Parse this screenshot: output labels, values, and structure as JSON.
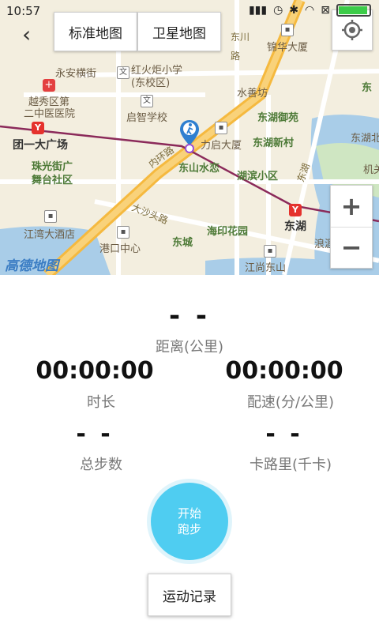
{
  "status_bar": {
    "time": "10:57"
  },
  "map": {
    "buttons": {
      "standard": "标准地图",
      "satellite": "卫星地图"
    },
    "zoom_in": "+",
    "zoom_out": "−",
    "logo": "高德地图",
    "labels": {
      "yongan": "永安横街",
      "hongyan": "红火炬小学",
      "hongyan_sub": "(东校区)",
      "yuexiu_hospital": "越秀区第",
      "yuexiu_hospital2": "二中医医院",
      "qizhi": "启智学校",
      "tuanyi": "团一大广场",
      "zhuguang": "珠光街广",
      "zhuguang2": "舞台社区",
      "huanlu": "内环路",
      "dongshan_shuilian": "东山水恋",
      "liqi": "力启大厦",
      "shuishan": "水善坊",
      "dongchuan": "东川",
      "dongchuan_road": "路",
      "jinhua": "锦华大厦",
      "donghu_yu": "东湖御苑",
      "donghu_xin": "东湖新村",
      "hubin": "湖滨小区",
      "donghu_road": "东湖",
      "donghu_road2": "路",
      "donghu": "东湖",
      "donghu_north": "东湖北",
      "dongshan": "东",
      "jiguan": "机关",
      "dasha": "大沙头路",
      "haiyin": "海印花园",
      "dongcheng": "东城",
      "jiangwan": "江湾大酒店",
      "gangkou": "港口中心",
      "jiangshang": "江尚东山",
      "langxue": "浪涯花园"
    }
  },
  "stats": {
    "distance": {
      "value": "- -",
      "label": "距离(公里)"
    },
    "duration": {
      "value": "00:00:00",
      "label": "时长"
    },
    "pace": {
      "value": "00:00:00",
      "label": "配速(分/公里)"
    },
    "steps": {
      "value": "- -",
      "label": "总步数"
    },
    "calories": {
      "value": "- -",
      "label": "卡路里(千卡)"
    }
  },
  "start_button": {
    "line1": "开始",
    "line2": "跑步"
  },
  "record_button": "运动记录",
  "colors": {
    "accent": "#4fcdf1",
    "road_main": "#f5b93f",
    "metro_line": "#8b2a5a",
    "water": "#a9cde8"
  }
}
